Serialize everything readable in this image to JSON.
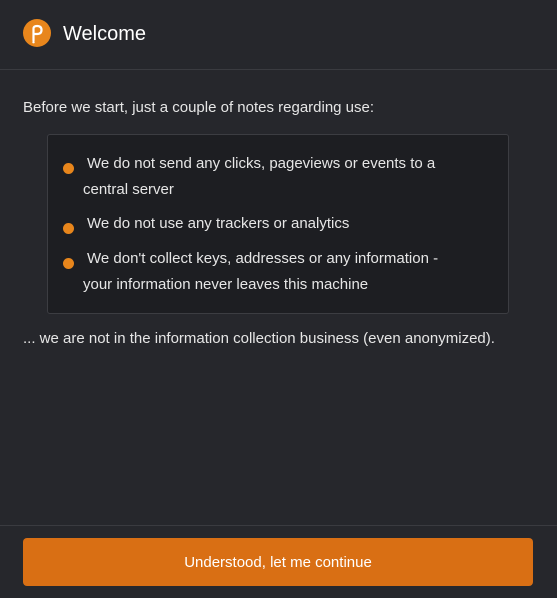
{
  "header": {
    "title": "Welcome",
    "logo_icon": "polkadot-p-logo-icon"
  },
  "intro": {
    "text": "Before we start, just a couple of notes regarding use:"
  },
  "notes": [
    {
      "line1": "We do not send any clicks, pageviews or events to a",
      "line2": "central server"
    },
    {
      "line1": "We do not use any trackers or analytics",
      "line2": ""
    },
    {
      "line1": "We don't collect keys, addresses or any information -",
      "line2": "your information never leaves this machine"
    }
  ],
  "outro": {
    "text": "... we are not in the information collection business (even anonymized)."
  },
  "footer": {
    "continue_label": "Understood, let me continue"
  },
  "colors": {
    "background": "#26272c",
    "accent": "#e8861c",
    "button": "#d96f14",
    "notes_box": "#1d1e22"
  }
}
